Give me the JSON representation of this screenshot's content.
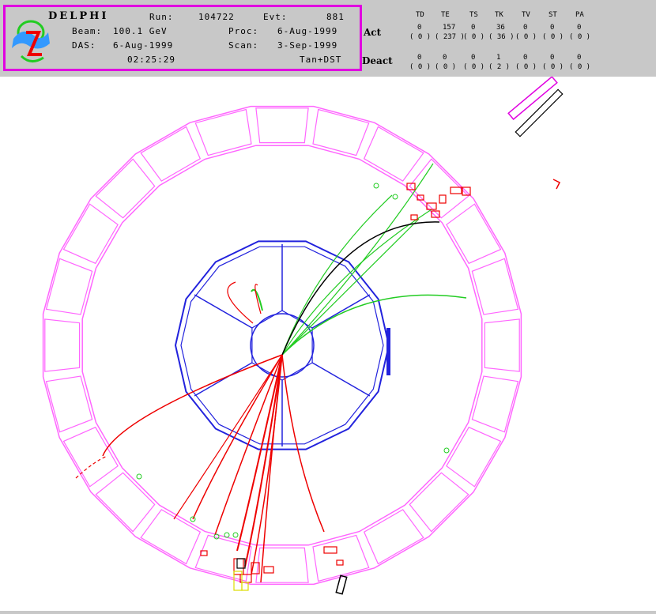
{
  "info": {
    "experiment": "DELPHI",
    "run_label": "Run:",
    "run": "104722",
    "evt_label": "Evt:",
    "evt": "881",
    "beam_label": "Beam:",
    "beam": "100.1 GeV",
    "proc_label": "Proc:",
    "proc": "6-Aug-1999",
    "das_label": "DAS:",
    "das": "6-Aug-1999",
    "scan_label": "Scan:",
    "scan": "3-Sep-1999",
    "time": "02:25:29",
    "tag": "Tan+DST"
  },
  "detector_table": {
    "columns": [
      "TD",
      "TE",
      "TS",
      "TK",
      "TV",
      "ST",
      "PA"
    ],
    "act_label": "Act",
    "act_top": [
      "0",
      "157",
      "0",
      "36",
      "0",
      "0",
      "0"
    ],
    "act_bottom": [
      "0",
      "237",
      "0",
      "36",
      "0",
      "0",
      "0"
    ],
    "deact_label": "Deact",
    "deact_top": [
      "0",
      "0",
      "0",
      "1",
      "0",
      "0",
      "0"
    ],
    "deact_bottom": [
      "0",
      "0",
      "0",
      "2",
      "0",
      "0",
      "0"
    ]
  },
  "colors": {
    "calorimeter": "#ff66ff",
    "tracker": "#2222dd",
    "track_red": "#ee0000",
    "track_green": "#22cc22",
    "track_black": "#000000",
    "frame_magenta": "#e000e0"
  }
}
